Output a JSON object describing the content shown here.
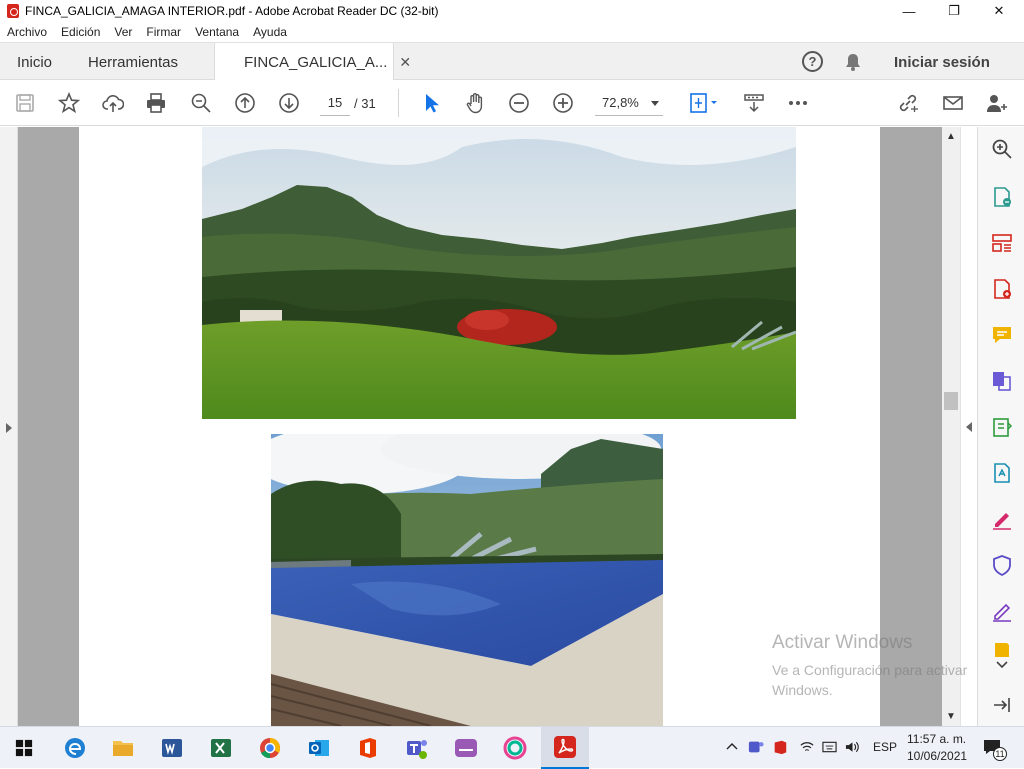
{
  "window": {
    "title": "FINCA_GALICIA_AMAGA INTERIOR.pdf - Adobe Acrobat Reader DC (32-bit)",
    "minimize_glyph": "—",
    "maximize_glyph": "❐",
    "close_glyph": "✕"
  },
  "menubar": {
    "items": [
      "Archivo",
      "Edición",
      "Ver",
      "Firmar",
      "Ventana",
      "Ayuda"
    ]
  },
  "tabs": {
    "home": "Inicio",
    "tools": "Herramientas",
    "document": "FINCA_GALICIA_A...",
    "close_glyph": "✕",
    "help_glyph": "?",
    "sign_in": "Iniciar sesión"
  },
  "toolbar": {
    "current_page": "15",
    "total_pages": "/ 31",
    "zoom": "72,8%"
  },
  "watermark": {
    "line1": "Activar Windows",
    "line2": "Ve a Configuración para activar Windows."
  },
  "taskbar": {
    "language": "ESP",
    "time": "11:57 a. m.",
    "date": "10/06/2021",
    "notification_count": "11"
  },
  "colors": {
    "acrobat_red": "#d4261c",
    "tool_blue": "#1473e6",
    "taskbar_bg": "#eef1f7"
  }
}
